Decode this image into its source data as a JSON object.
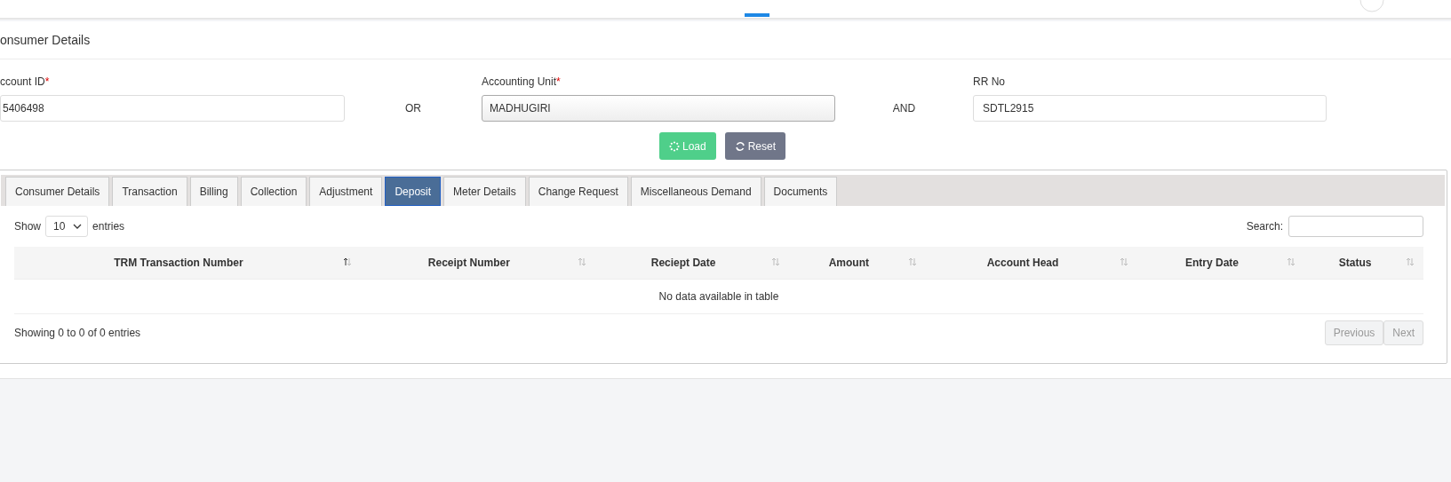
{
  "card_title": "onsumer Details",
  "fields": [
    {
      "label": "ccount ID",
      "required_mark": "*",
      "value": "5406498",
      "kind": "text"
    },
    {
      "label": "Accounting Unit",
      "required_mark": "*",
      "value": "MADHUGIRI",
      "kind": "select"
    },
    {
      "label": "RR No",
      "value": "SDTL2915",
      "kind": "text"
    }
  ],
  "connectors": [
    "OR",
    "AND"
  ],
  "buttons": [
    {
      "label": "Load",
      "kind": "load"
    },
    {
      "label": "Reset",
      "kind": "reset"
    }
  ],
  "tabs": [
    {
      "label": "Consumer Details",
      "selected": false
    },
    {
      "label": "Transaction",
      "selected": false
    },
    {
      "label": "Billing",
      "selected": false
    },
    {
      "label": "Collection",
      "selected": false
    },
    {
      "label": "Adjustment",
      "selected": false
    },
    {
      "label": "Deposit",
      "selected": true
    },
    {
      "label": "Meter Details",
      "selected": false
    },
    {
      "label": "Change Request",
      "selected": false
    },
    {
      "label": "Miscellaneous Demand",
      "selected": false
    },
    {
      "label": "Documents",
      "selected": false
    }
  ],
  "length_menu": {
    "before": "Show",
    "value": "10",
    "after": "entries"
  },
  "search": {
    "label": "Search:"
  },
  "table": {
    "columns": [
      {
        "label": "TRM Transaction Number",
        "sorted": true
      },
      {
        "label": "Receipt Number",
        "sorted": false
      },
      {
        "label": "Reciept Date",
        "sorted": false
      },
      {
        "label": "Amount",
        "sorted": false
      },
      {
        "label": "Account Head",
        "sorted": false
      },
      {
        "label": "Entry Date",
        "sorted": false
      },
      {
        "label": "Status",
        "sorted": false
      }
    ],
    "empty_message": "No data available in table"
  },
  "info": "Showing 0 to 0 of 0 entries",
  "pagination": [
    {
      "label": "Previous",
      "disabled": true
    },
    {
      "label": "Next",
      "disabled": true
    }
  ]
}
